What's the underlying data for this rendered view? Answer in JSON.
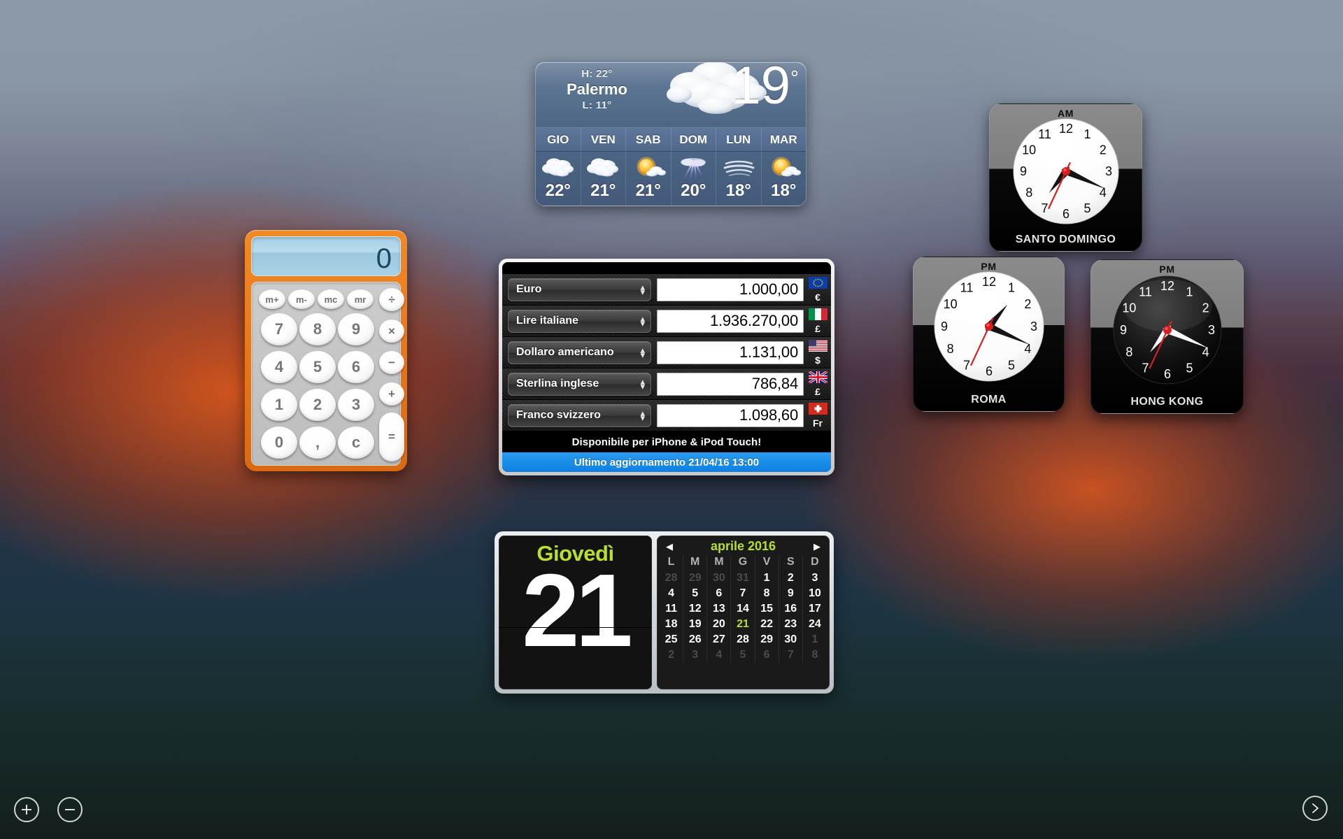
{
  "desktop": {
    "name": "macOS Dashboard",
    "background_colors": {
      "top": "#8c9aa8",
      "mid_warm": "#d6561c",
      "bottom": "#131f1d"
    }
  },
  "controls": {
    "add_label": "+",
    "remove_label": "−",
    "next_label": "›"
  },
  "weather": {
    "city": "Palermo",
    "high": "H: 22°",
    "low": "L: 11°",
    "current_temp": "19",
    "degree": "°",
    "current_condition": "cloudy",
    "forecast": [
      {
        "day": "GIO",
        "temp": "22°",
        "icon": "cloudy"
      },
      {
        "day": "VEN",
        "temp": "21°",
        "icon": "cloudy"
      },
      {
        "day": "SAB",
        "temp": "21°",
        "icon": "partly-sunny"
      },
      {
        "day": "DOM",
        "temp": "20°",
        "icon": "thunderstorm"
      },
      {
        "day": "LUN",
        "temp": "18°",
        "icon": "fog"
      },
      {
        "day": "MAR",
        "temp": "18°",
        "icon": "partly-sunny"
      }
    ]
  },
  "calculator": {
    "display_value": "0",
    "memory_keys": [
      "m+",
      "m-",
      "mc",
      "mr"
    ],
    "digit_keys": [
      "7",
      "8",
      "9",
      "4",
      "5",
      "6",
      "1",
      "2",
      "3",
      "0",
      ",",
      "c"
    ],
    "operator_keys": [
      "÷",
      "×",
      "−",
      "+"
    ],
    "equals_key": "="
  },
  "converter": {
    "rows": [
      {
        "currency": "Euro",
        "amount": "1.000,00",
        "symbol": "€",
        "flag": "eu"
      },
      {
        "currency": "Lire italiane",
        "amount": "1.936.270,00",
        "symbol": "£",
        "flag": "it"
      },
      {
        "currency": "Dollaro americano",
        "amount": "1.131,00",
        "symbol": "$",
        "flag": "us"
      },
      {
        "currency": "Sterlina inglese",
        "amount": "786,84",
        "symbol": "£",
        "flag": "gb"
      },
      {
        "currency": "Franco svizzero",
        "amount": "1.098,60",
        "symbol": "Fr",
        "flag": "ch"
      }
    ],
    "promo": "Disponibile per iPhone & iPod Touch!",
    "update": "Ultimo aggiornamento 21/04/16 13:00",
    "update_bar_color": "#1787e6"
  },
  "calendar": {
    "weekday": "Giovedì",
    "day_number": "21",
    "month_year": "aprile 2016",
    "prev_arrow": "◀",
    "next_arrow": "▶",
    "accent_color": "#b6e02c",
    "dow_headers": [
      "L",
      "M",
      "M",
      "G",
      "V",
      "S",
      "D"
    ],
    "weeks": [
      [
        {
          "d": "28",
          "t": "dim"
        },
        {
          "d": "29",
          "t": "dim"
        },
        {
          "d": "30",
          "t": "dim"
        },
        {
          "d": "31",
          "t": "dim"
        },
        {
          "d": "1",
          "t": ""
        },
        {
          "d": "2",
          "t": ""
        },
        {
          "d": "3",
          "t": ""
        }
      ],
      [
        {
          "d": "4",
          "t": ""
        },
        {
          "d": "5",
          "t": ""
        },
        {
          "d": "6",
          "t": ""
        },
        {
          "d": "7",
          "t": ""
        },
        {
          "d": "8",
          "t": ""
        },
        {
          "d": "9",
          "t": ""
        },
        {
          "d": "10",
          "t": ""
        }
      ],
      [
        {
          "d": "11",
          "t": ""
        },
        {
          "d": "12",
          "t": ""
        },
        {
          "d": "13",
          "t": ""
        },
        {
          "d": "14",
          "t": ""
        },
        {
          "d": "15",
          "t": ""
        },
        {
          "d": "16",
          "t": ""
        },
        {
          "d": "17",
          "t": ""
        }
      ],
      [
        {
          "d": "18",
          "t": ""
        },
        {
          "d": "19",
          "t": ""
        },
        {
          "d": "20",
          "t": ""
        },
        {
          "d": "21",
          "t": "today"
        },
        {
          "d": "22",
          "t": ""
        },
        {
          "d": "23",
          "t": ""
        },
        {
          "d": "24",
          "t": ""
        }
      ],
      [
        {
          "d": "25",
          "t": ""
        },
        {
          "d": "26",
          "t": ""
        },
        {
          "d": "27",
          "t": ""
        },
        {
          "d": "28",
          "t": ""
        },
        {
          "d": "29",
          "t": ""
        },
        {
          "d": "30",
          "t": ""
        },
        {
          "d": "1",
          "t": "dim"
        }
      ],
      [
        {
          "d": "2",
          "t": "dim"
        },
        {
          "d": "3",
          "t": "dim"
        },
        {
          "d": "4",
          "t": "dim"
        },
        {
          "d": "5",
          "t": "dim"
        },
        {
          "d": "6",
          "t": "dim"
        },
        {
          "d": "7",
          "t": "dim"
        },
        {
          "d": "8",
          "t": "dim"
        }
      ]
    ]
  },
  "clocks": [
    {
      "id": "sd",
      "city": "SANTO DOMINGO",
      "meridiem": "AM",
      "face": "light",
      "hour_deg": 218,
      "minute_deg": 114,
      "second_deg": 205,
      "hour_numerals": [
        "12",
        "1",
        "2",
        "3",
        "4",
        "5",
        "6",
        "7",
        "8",
        "9",
        "10",
        "11"
      ]
    },
    {
      "id": "rm",
      "city": "ROMA",
      "meridiem": "PM",
      "face": "light",
      "hour_deg": 40,
      "minute_deg": 114,
      "second_deg": 205,
      "hour_numerals": [
        "12",
        "1",
        "2",
        "3",
        "4",
        "5",
        "6",
        "7",
        "8",
        "9",
        "10",
        "11"
      ]
    },
    {
      "id": "hk",
      "city": "HONG KONG",
      "meridiem": "PM",
      "face": "dark",
      "hour_deg": 218,
      "minute_deg": 114,
      "second_deg": 205,
      "hour_numerals": [
        "12",
        "1",
        "2",
        "3",
        "4",
        "5",
        "6",
        "7",
        "8",
        "9",
        "10",
        "11"
      ]
    }
  ]
}
